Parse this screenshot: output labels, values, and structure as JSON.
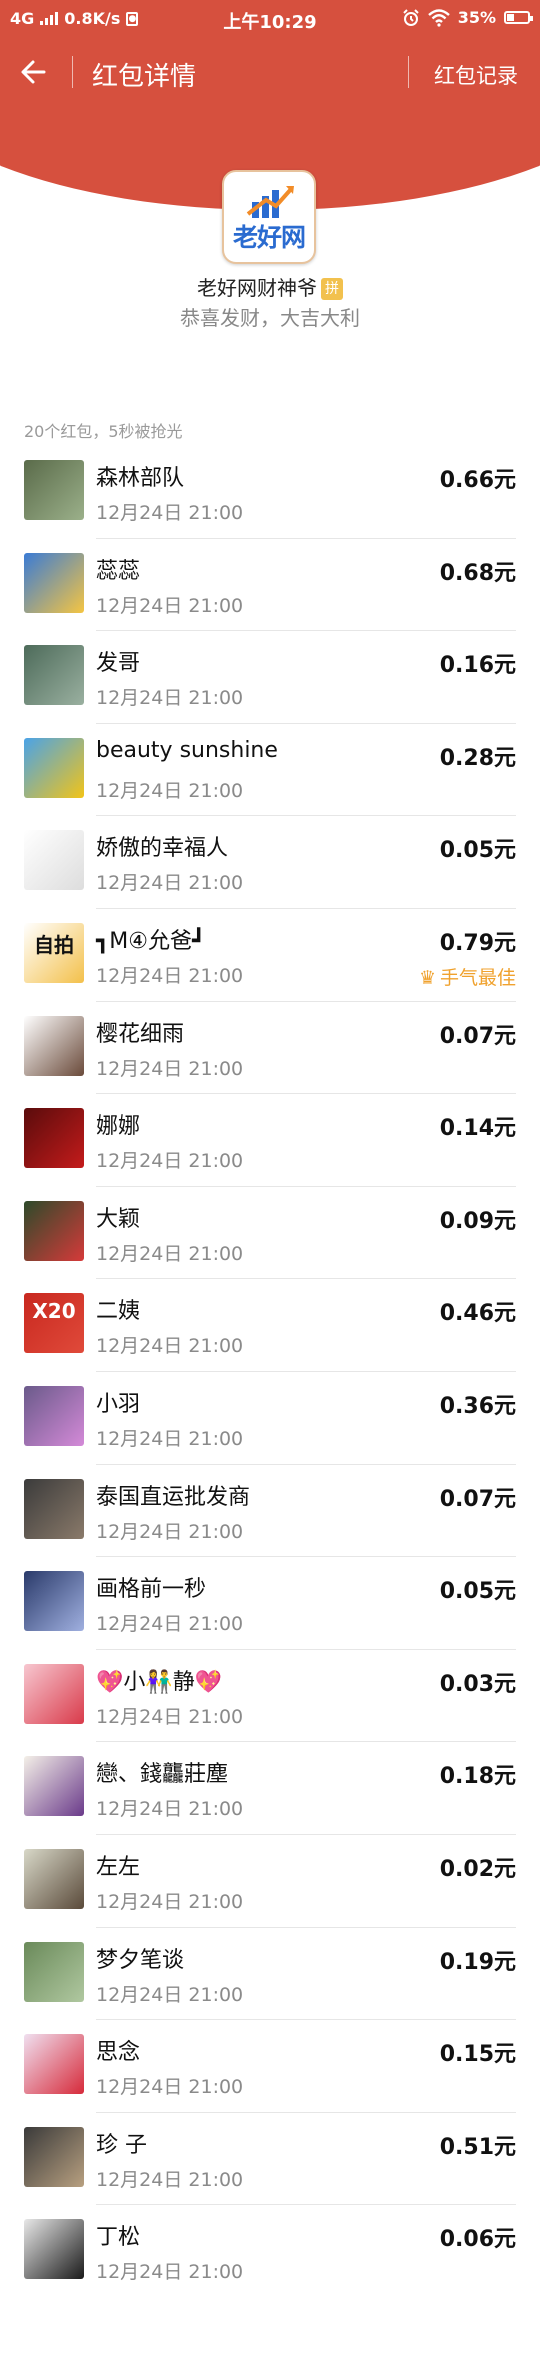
{
  "status_bar": {
    "network": "4G",
    "speed": "0.8K/s",
    "time": "上午10:29",
    "battery": "35%"
  },
  "navbar": {
    "title": "红包详情",
    "record_label": "红包记录"
  },
  "sender": {
    "logo_text": "老好网",
    "name": "老好网财神爷",
    "badge": "拼",
    "blessing": "恭喜发财，大吉大利"
  },
  "summary": "20个红包，5秒被抢光",
  "colors": {
    "header_red": "#D6503E",
    "best_luck": "#F0A22E"
  },
  "entries": [
    {
      "name": "森林部队",
      "time": "12月24日  21:00",
      "amount": "0.66元"
    },
    {
      "name": "蕊蕊",
      "time": "12月24日  21:00",
      "amount": "0.68元"
    },
    {
      "name": "发哥",
      "time": "12月24日  21:00",
      "amount": "0.16元"
    },
    {
      "name": "beauty sunshine",
      "time": "12月24日  21:00",
      "amount": "0.28元"
    },
    {
      "name": "娇傲的幸福人",
      "time": "12月24日  21:00",
      "amount": "0.05元"
    },
    {
      "name": "┓M④允爸┛",
      "time": "12月24日  21:00",
      "amount": "0.79元",
      "best": "手气最佳",
      "avatar_text": "自拍"
    },
    {
      "name": "樱花细雨",
      "time": "12月24日  21:00",
      "amount": "0.07元"
    },
    {
      "name": "娜娜",
      "time": "12月24日  21:00",
      "amount": "0.14元"
    },
    {
      "name": "大颖",
      "time": "12月24日  21:00",
      "amount": "0.09元"
    },
    {
      "name": "二姨",
      "time": "12月24日  21:00",
      "amount": "0.46元",
      "avatar_text": "X20"
    },
    {
      "name": "小羽",
      "time": "12月24日  21:00",
      "amount": "0.36元"
    },
    {
      "name": "泰国直运批发商",
      "time": "12月24日  21:00",
      "amount": "0.07元"
    },
    {
      "name": "画格前一秒",
      "time": "12月24日  21:00",
      "amount": "0.05元"
    },
    {
      "name": "💖小👫静💖",
      "time": "12月24日  21:00",
      "amount": "0.03元"
    },
    {
      "name": "戀、錢龘莊塵",
      "time": "12月24日  21:00",
      "amount": "0.18元"
    },
    {
      "name": "左左",
      "time": "12月24日  21:00",
      "amount": "0.02元"
    },
    {
      "name": "梦夕笔谈",
      "time": "12月24日  21:00",
      "amount": "0.19元"
    },
    {
      "name": "思念",
      "time": "12月24日  21:00",
      "amount": "0.15元"
    },
    {
      "name": "珍 子",
      "time": "12月24日  21:00",
      "amount": "0.51元"
    },
    {
      "name": "丁松",
      "time": "12月24日  21:00",
      "amount": "0.06元"
    }
  ]
}
